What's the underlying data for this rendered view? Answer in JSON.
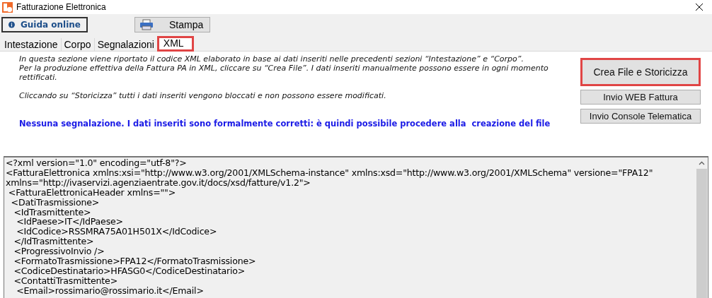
{
  "window": {
    "title": "Fatturazione Elettronica"
  },
  "toolbar": {
    "help_button": "Guida online",
    "print_button": "Stampa"
  },
  "tabs": [
    {
      "label": "Intestazione",
      "selected": false,
      "highlighted": false
    },
    {
      "label": "Corpo",
      "selected": false,
      "highlighted": false
    },
    {
      "label": "Segnalazioni",
      "selected": false,
      "highlighted": false
    },
    {
      "label": "XML",
      "selected": true,
      "highlighted": true
    }
  ],
  "description": [
    "In questa sezione viene riportato il codice XML elaborato in base ai dati inseriti nelle precedenti sezioni “Intestazione” e “Corpo”.",
    "Per la produzione effettiva della Fattura PA in XML, cliccare su “Crea File”. I dati inseriti manualmente possono essere in ogni momento rettificati.",
    "Cliccando su “Storicizza” tutti i dati inseriti vengono bloccati e non possono essere modificati."
  ],
  "status_message": "Nessuna segnalazione. I dati inseriti sono formalmente corretti: è quindi possibile procedere alla  creazione del file",
  "actions": [
    {
      "label": "Crea File e Storicizza",
      "highlighted": true
    },
    {
      "label": "Invio WEB Fattura",
      "highlighted": false
    },
    {
      "label": "Invio Console Telematica",
      "highlighted": false
    }
  ],
  "xml_lines": [
    "<?xml version=\"1.0\" encoding=\"utf-8\"?>",
    "<FatturaElettronica xmlns:xsi=\"http://www.w3.org/2001/XMLSchema-instance\" xmlns:xsd=\"http://www.w3.org/2001/XMLSchema\" versione=\"FPA12\"",
    "xmlns=\"http://ivaservizi.agenziaentrate.gov.it/docs/xsd/fatture/v1.2\">",
    " <FatturaElettronicaHeader xmlns=\"\">",
    "  <DatiTrasmissione>",
    "   <IdTrasmittente>",
    "    <IdPaese>IT</IdPaese>",
    "    <IdCodice>RSSMRA75A01H501X</IdCodice>",
    "   </IdTrasmittente>",
    "   <ProgressivoInvio />",
    "   <FormatoTrasmissione>FPA12</FormatoTrasmissione>",
    "   <CodiceDestinatario>HFASG0</CodiceDestinatario>",
    "   <ContattiTrasmittente>",
    "    <Email>rossimario@rossimario.it</Email>"
  ]
}
